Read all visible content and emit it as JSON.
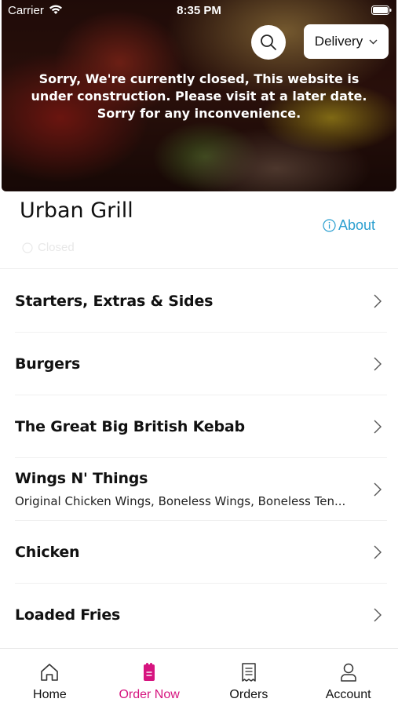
{
  "status_bar": {
    "carrier": "Carrier",
    "time": "8:35 PM"
  },
  "hero": {
    "delivery_label": "Delivery",
    "closed_notice": "Sorry, We're currently closed, This website is under construction. Please visit at a later date. Sorry for any inconvenience."
  },
  "restaurant": {
    "name": "Urban Grill",
    "about_label": "About",
    "status": "Closed"
  },
  "categories": [
    {
      "title": "Starters, Extras & Sides",
      "subtitle": ""
    },
    {
      "title": "Burgers",
      "subtitle": ""
    },
    {
      "title": "The Great Big British Kebab",
      "subtitle": ""
    },
    {
      "title": "Wings N' Things",
      "subtitle": "Original Chicken Wings, Boneless Wings, Boneless Ten..."
    },
    {
      "title": "Chicken",
      "subtitle": ""
    },
    {
      "title": "Loaded Fries",
      "subtitle": ""
    }
  ],
  "tabs": [
    {
      "label": "Home",
      "icon": "home-icon"
    },
    {
      "label": "Order Now",
      "icon": "order-now-icon",
      "active": true
    },
    {
      "label": "Orders",
      "icon": "receipt-icon"
    },
    {
      "label": "Account",
      "icon": "account-icon"
    }
  ],
  "colors": {
    "accent": "#d6147f",
    "link": "#2a9fd0"
  }
}
